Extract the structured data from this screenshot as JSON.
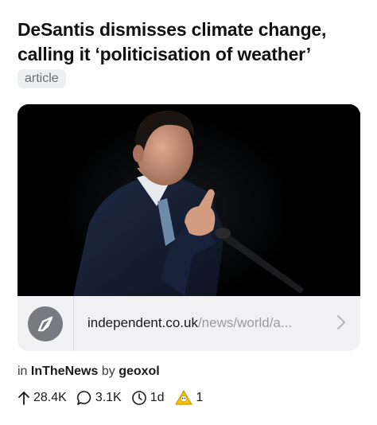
{
  "post": {
    "title": "DeSantis dismisses climate change, calling it ‘politicisation of weather’",
    "flair": "article"
  },
  "link": {
    "domain": "independent.co.uk",
    "path": "/news/world/a...",
    "icon": "compass-icon"
  },
  "meta": {
    "in_prefix": "in",
    "subreddit": "InTheNews",
    "by_prefix": "by",
    "author": "geoxol"
  },
  "stats": {
    "upvotes": "28.4K",
    "comments": "3.1K",
    "age": "1d",
    "awards": "1"
  },
  "colors": {
    "flair_bg": "#eeeff1",
    "link_bar_bg": "#f1f1f4",
    "compass_bg": "#787a7f",
    "award": "#f5c400"
  }
}
